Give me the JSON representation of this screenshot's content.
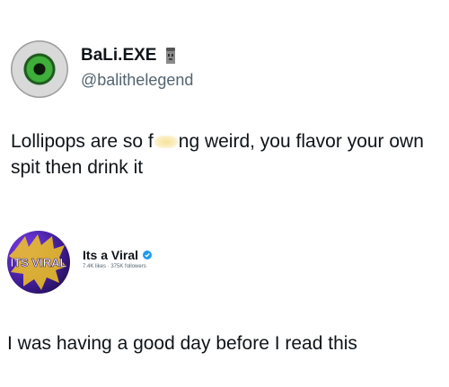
{
  "tweet": {
    "display_name": "BaLi.EXE",
    "handle": "@balithelegend",
    "text_before_censor": "Lollipops are so f",
    "text_after_censor": "ng weird, you flavor your own spit then drink it"
  },
  "page": {
    "name": "Its a Viral",
    "stats": "7.4K likes · 375K followers",
    "avatar_text": "ITS VIRAL",
    "post_text": "I was having a good day before I read this"
  },
  "icons": {
    "name_badge": "moai-icon",
    "verified": "verified-badge-icon"
  },
  "colors": {
    "handle": "#536471",
    "verified": "#1d9bf0"
  }
}
